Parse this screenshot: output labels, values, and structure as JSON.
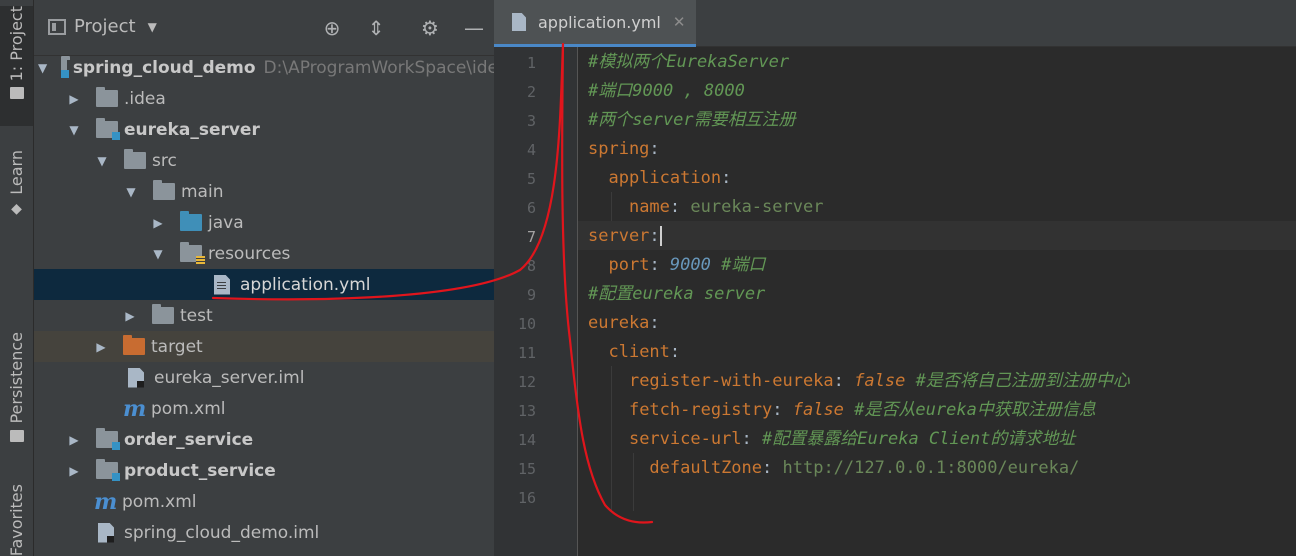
{
  "toolwindow_strip": {
    "project_label": "1: Project",
    "learn_label": "Learn",
    "persistence_label": "Persistence",
    "favorites_label": "Favorites"
  },
  "project_panel": {
    "title": "Project"
  },
  "tree": [
    {
      "label": "spring_cloud_demo",
      "path": "D:\\AProgramWorkSpace\\ide"
    },
    {
      "label": ".idea"
    },
    {
      "label": "eureka_server"
    },
    {
      "label": "src"
    },
    {
      "label": "main"
    },
    {
      "label": "java"
    },
    {
      "label": "resources"
    },
    {
      "label": "application.yml"
    },
    {
      "label": "test"
    },
    {
      "label": "target"
    },
    {
      "label": "eureka_server.iml"
    },
    {
      "label": "pom.xml"
    },
    {
      "label": "order_service"
    },
    {
      "label": "product_service"
    },
    {
      "label": "pom.xml"
    },
    {
      "label": "spring_cloud_demo.iml"
    }
  ],
  "editor": {
    "tab_label": "application.yml",
    "line_numbers": [
      "1",
      "2",
      "3",
      "4",
      "5",
      "6",
      "7",
      "8",
      "9",
      "10",
      "11",
      "12",
      "13",
      "14",
      "15",
      "16"
    ],
    "current_line": "7",
    "lines": {
      "l1": "#模拟两个EurekaServer",
      "l2": "#端口9000 , 8000",
      "l3": "#两个server需要相互注册",
      "l4_key": "spring",
      "l5_key": "application",
      "l6_key": "name",
      "l6_val": "eureka-server",
      "l7_key": "server",
      "l8_key": "port",
      "l8_val": "9000",
      "l8_cmt": "#端口",
      "l9": "#配置eureka server",
      "l10_key": "eureka",
      "l11_key": "client",
      "l12_key": "register-with-eureka",
      "l12_val": "false",
      "l12_cmt": "#是否将自己注册到注册中心",
      "l13_key": "fetch-registry",
      "l13_val": "false",
      "l13_cmt": "#是否从eureka中获取注册信息",
      "l14_key": "service-url",
      "l14_cmt": "#配置暴露给Eureka Client的请求地址",
      "l15_key": "defaultZone",
      "l15_val": "http://127.0.0.1:8000/eureka/"
    }
  },
  "colors": {
    "annotation_stroke": "#e0151c",
    "selection": "#0d293e",
    "yaml_key": "#cc7832",
    "yaml_comment": "#629755",
    "yaml_number": "#6897bb"
  }
}
